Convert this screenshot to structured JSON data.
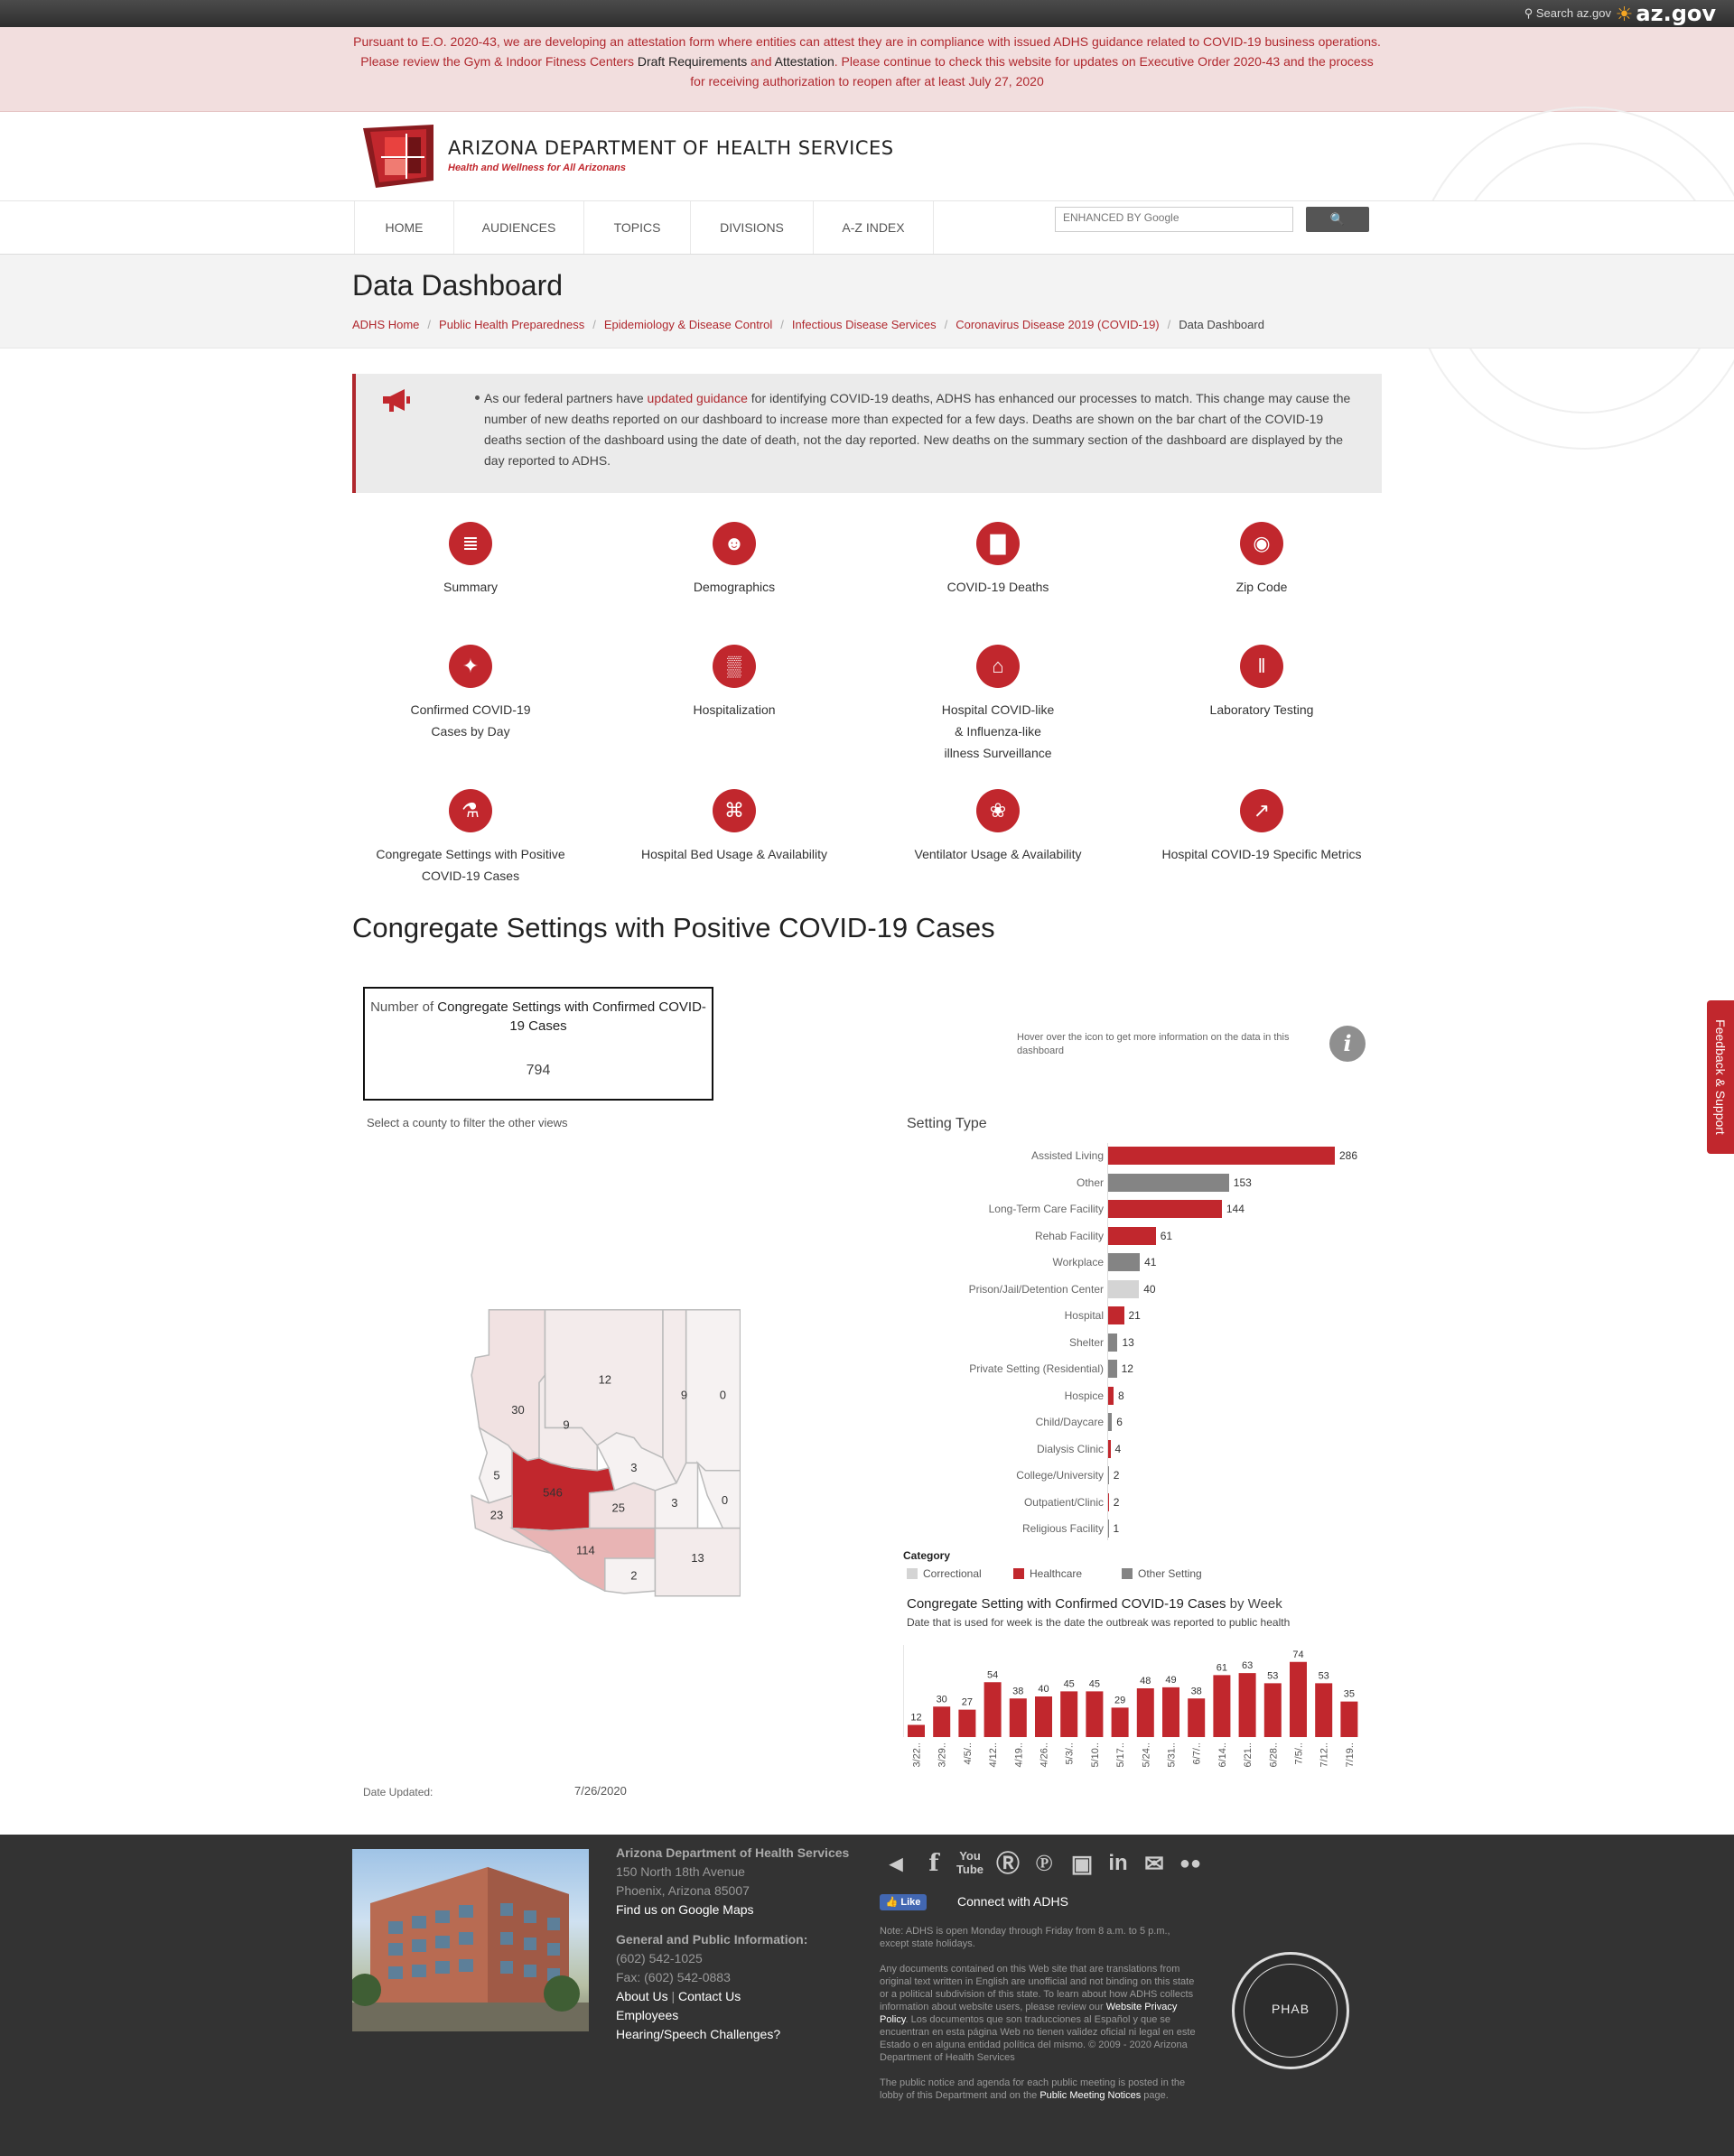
{
  "topbar": {
    "search_label": "Search az.gov",
    "brand": "az.gov"
  },
  "alert": {
    "text_before": "Pursuant to E.O. 2020-43, we are developing an attestation form where entities can attest they are in compliance with issued ADHS guidance related to COVID-19 business operations. Please review the Gym & Indoor Fitness Centers ",
    "link1": "Draft Requirements",
    "and": " and ",
    "link2": "Attestation",
    "text_after": ". Please continue to check this website for updates on Executive Order 2020-43 and the process for receiving authorization to reopen after at least July 27, 2020"
  },
  "header": {
    "agency": "ARIZONA DEPARTMENT OF HEALTH SERVICES",
    "tagline": "Health and Wellness for All Arizonans"
  },
  "nav": {
    "items": [
      "HOME",
      "AUDIENCES",
      "TOPICS",
      "DIVISIONS",
      "A-Z INDEX"
    ],
    "search_placeholder": "ENHANCED BY Google"
  },
  "page": {
    "title": "Data Dashboard",
    "breadcrumbs": [
      "ADHS Home",
      "Public Health Preparedness",
      "Epidemiology & Disease Control",
      "Infectious Disease Services",
      "Coronavirus Disease 2019 (COVID-19)",
      "Data Dashboard"
    ]
  },
  "notice": {
    "before": "As our federal partners have ",
    "link": "updated guidance",
    "after": " for identifying COVID-19 deaths, ADHS has enhanced our processes to match. This change may cause the number of new deaths reported on our dashboard to increase more than expected for a few days. Deaths are shown on the bar chart of the COVID-19 deaths section of the dashboard using the date of death, not the day reported. New deaths on the summary section of the dashboard are displayed by the day reported to ADHS."
  },
  "tiles": [
    {
      "label": "Summary",
      "icon": "document-icon"
    },
    {
      "label": "Demographics",
      "icon": "people-icon"
    },
    {
      "label": "COVID-19 Deaths",
      "icon": "bar-chart-icon"
    },
    {
      "label": "Zip Code",
      "icon": "map-pin-icon"
    },
    {
      "label": "Confirmed COVID-19\nCases by Day",
      "icon": "network-icon"
    },
    {
      "label": "Hospitalization",
      "icon": "hospital-beds-icon"
    },
    {
      "label": "Hospital COVID-like\n& Influenza-like\nillness Surveillance",
      "icon": "hospital-building-icon"
    },
    {
      "label": "Laboratory Testing",
      "icon": "test-tubes-icon"
    },
    {
      "label": "Congregate Settings with Positive\nCOVID-19 Cases",
      "icon": "microscope-icon"
    },
    {
      "label": "Hospital Bed Usage & Availability",
      "icon": "hospital-bed-icon"
    },
    {
      "label": "Ventilator Usage & Availability",
      "icon": "lungs-icon"
    },
    {
      "label": "Hospital COVID-19 Specific Metrics",
      "icon": "trend-chart-icon"
    }
  ],
  "section": {
    "title": "Congregate Settings with Positive COVID-19 Cases",
    "kpi_prefix": "Number of ",
    "kpi_label": "Congregate Settings with Confirmed COVID-19 Cases",
    "kpi_value": "794",
    "filter_hint": "Select a county to filter the other views",
    "hover_hint": "Hover over the icon to get more information on the data in this dashboard",
    "info_icon_glyph": "i",
    "date_label": "Date Updated:",
    "date_value": "7/26/2020"
  },
  "map": {
    "counties": [
      {
        "name": "Mohave",
        "value": 30
      },
      {
        "name": "Coconino",
        "value": 12
      },
      {
        "name": "Navajo",
        "value": 9
      },
      {
        "name": "Apache",
        "value": 0
      },
      {
        "name": "Yavapai",
        "value": 9
      },
      {
        "name": "La Paz",
        "value": 5
      },
      {
        "name": "Gila",
        "value": 3
      },
      {
        "name": "Maricopa",
        "value": 546
      },
      {
        "name": "Pinal",
        "value": 25
      },
      {
        "name": "Graham",
        "value": 3
      },
      {
        "name": "Greenlee",
        "value": 0
      },
      {
        "name": "Yuma",
        "value": 23
      },
      {
        "name": "Pima",
        "value": 114
      },
      {
        "name": "Santa Cruz",
        "value": 2
      },
      {
        "name": "Cochise",
        "value": 13
      }
    ]
  },
  "chart_data": [
    {
      "type": "bar",
      "orientation": "horizontal",
      "title": "Setting Type",
      "categories": [
        "Assisted Living",
        "Other",
        "Long-Term Care Facility",
        "Rehab Facility",
        "Workplace",
        "Prison/Jail/Detention Center",
        "Hospital",
        "Shelter",
        "Private Setting (Residential)",
        "Hospice",
        "Child/Daycare",
        "Dialysis Clinic",
        "College/University",
        "Outpatient/Clinic",
        "Religious Facility"
      ],
      "values": [
        286,
        153,
        144,
        61,
        41,
        40,
        21,
        13,
        12,
        8,
        6,
        4,
        2,
        2,
        1
      ],
      "category_group": [
        "Healthcare",
        "Other Setting",
        "Healthcare",
        "Healthcare",
        "Other Setting",
        "Correctional",
        "Healthcare",
        "Other Setting",
        "Other Setting",
        "Healthcare",
        "Other Setting",
        "Healthcare",
        "Other Setting",
        "Healthcare",
        "Other Setting"
      ],
      "legend": {
        "title": "Category",
        "entries": [
          {
            "name": "Correctional",
            "color": "#d4d4d4"
          },
          {
            "name": "Healthcare",
            "color": "#c1272d"
          },
          {
            "name": "Other Setting",
            "color": "#848484"
          }
        ]
      }
    },
    {
      "type": "bar",
      "title_prefix": "Congregate Setting with Confirmed COVID-19 Cases",
      "title_suffix": " by Week",
      "subtitle": "Date that is used for week is the date the outbreak was reported to public health",
      "categories": [
        "3/22..",
        "3/29..",
        "4/5/..",
        "4/12..",
        "4/19..",
        "4/26..",
        "5/3/..",
        "5/10..",
        "5/17..",
        "5/24..",
        "5/31..",
        "6/7/..",
        "6/14..",
        "6/21..",
        "6/28..",
        "7/5/..",
        "7/12..",
        "7/19.."
      ],
      "values": [
        12,
        30,
        27,
        54,
        38,
        40,
        45,
        45,
        29,
        48,
        49,
        38,
        61,
        63,
        53,
        74,
        53,
        35
      ],
      "color": "#c1272d"
    }
  ],
  "feedback": {
    "label": "Feedback & Support"
  },
  "footer": {
    "name": "Arizona Department of Health Services",
    "street": "150 North 18th Avenue",
    "city": "Phoenix, Arizona 85007",
    "maps_link": "Find us on Google Maps",
    "info_head": "General and Public Information:",
    "phone": "(602) 542-1025",
    "fax": "Fax: (602) 542-0883",
    "about": "About Us",
    "contact": "Contact Us",
    "employees": "Employees",
    "hearing": "Hearing/Speech Challenges?",
    "fb_like": "Like",
    "connect": "Connect with ADHS",
    "note_hours": "Note: ADHS is open Monday through Friday from 8 a.m. to 5 p.m., except state holidays.",
    "note_translation_before": "Any documents contained on this Web site that are translations from original text written in English are unofficial and not binding on this state or a political subdivision of this state. To learn about how ADHS collects information about website users, please review our ",
    "privacy_link": "Website Privacy Policy",
    "note_translation_after": ". Los documentos que son traducciones al Español y que se encuentran en esta página Web no tienen validez oficial ni legal en este Estado o en alguna entidad política del mismo. © 2009 - 2020 Arizona Department of Health Services",
    "note_meeting_before": "The public notice and agenda for each public meeting is posted in the lobby of this Department and on the ",
    "meeting_link": "Public Meeting Notices",
    "note_meeting_after": " page.",
    "phab": "PHAB"
  }
}
